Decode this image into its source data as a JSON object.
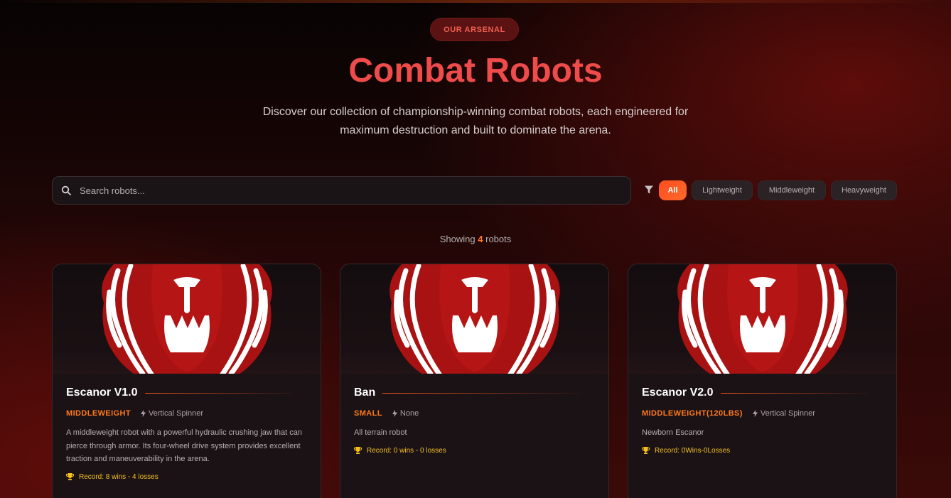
{
  "header": {
    "badge": "OUR ARSENAL",
    "title": "Combat Robots",
    "subtitle": "Discover our collection of championship-winning combat robots, each engineered for maximum destruction and built to dominate the arena."
  },
  "search": {
    "placeholder": "Search robots..."
  },
  "filters": [
    "All",
    "Lightweight",
    "Middleweight",
    "Heavyweight"
  ],
  "active_filter": "All",
  "showing": {
    "prefix": "Showing",
    "count": "4",
    "suffix": "robots"
  },
  "robots": [
    {
      "name": "Escanor V1.0",
      "weight": "MIDDLEWEIGHT",
      "weapon": "Vertical Spinner",
      "description": "A middleweight robot with a powerful hydraulic crushing jaw that can pierce through armor. Its four-wheel drive system provides excellent traction and maneuverability in the arena.",
      "record": "Record: 8 wins - 4 losses"
    },
    {
      "name": "Ban",
      "weight": "SMALL",
      "weapon": "None",
      "description": "All terrain robot",
      "record": "Record: 0 wins - 0 losses"
    },
    {
      "name": "Escanor V2.0",
      "weight": "MIDDLEWEIGHT(120LBS)",
      "weapon": "Vertical Spinner",
      "description": "Newborn Escanor",
      "record": "Record: 0Wins-0Losses"
    }
  ],
  "colors": {
    "accent": "#ff5a24",
    "title": "#ef4b4b",
    "weight": "#ff7a1a",
    "record": "#f4c020"
  },
  "icons": [
    "search-icon",
    "filter-icon",
    "bolt-icon",
    "trophy-icon",
    "lion-logo"
  ]
}
